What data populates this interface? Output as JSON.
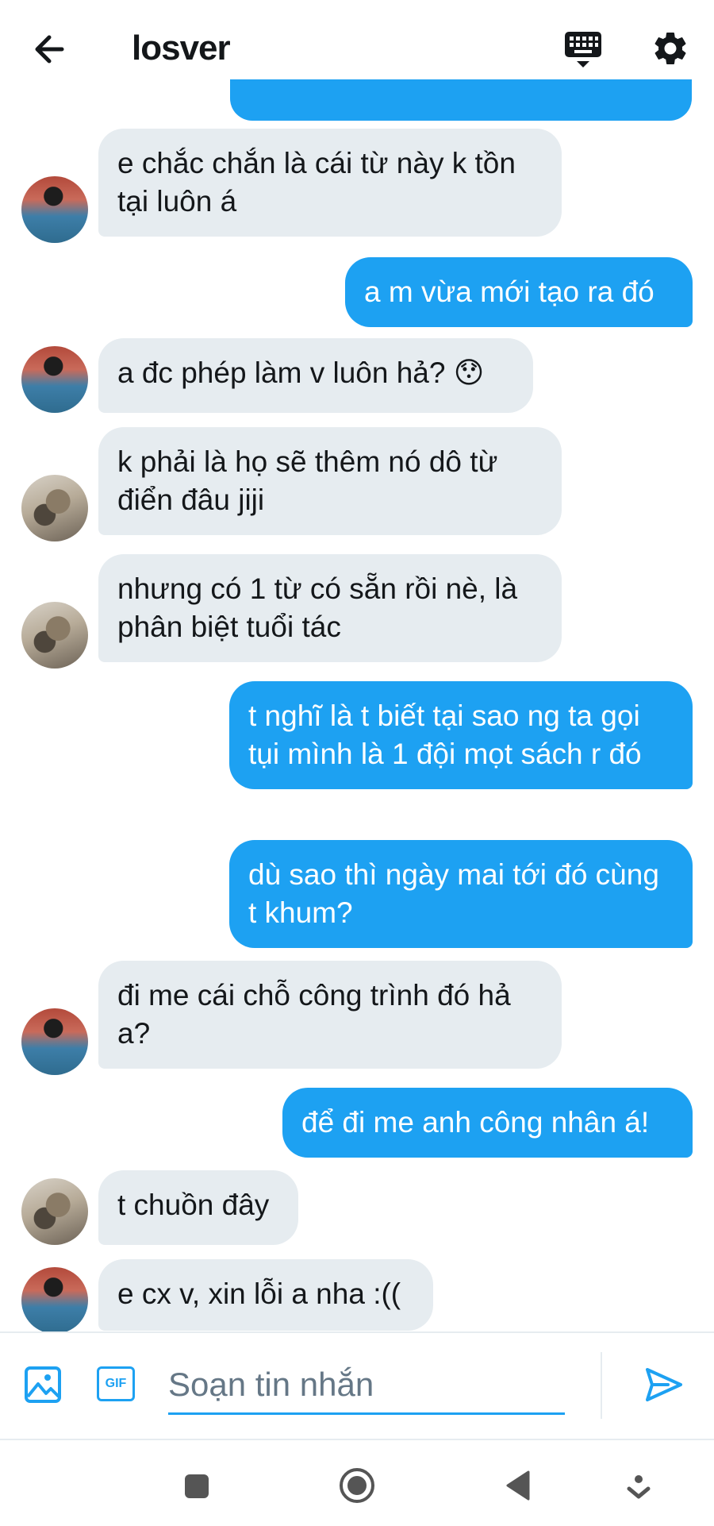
{
  "header": {
    "title": "losver",
    "back_icon": "arrow-left-icon",
    "keyboard_icon": "keyboard-icon",
    "settings_icon": "gear-icon"
  },
  "messages": [
    {
      "side": "in",
      "avatar": "a",
      "text": "e chắc chắn là cái từ này k tồn tại luôn á"
    },
    {
      "side": "out",
      "text": "a m vừa mới tạo ra đó"
    },
    {
      "side": "in",
      "avatar": "a",
      "text": "a đc phép làm v luôn hả? 😯"
    },
    {
      "side": "in",
      "avatar": "b",
      "text": "k phải là họ sẽ thêm nó dô từ điển đâu jiji"
    },
    {
      "side": "in",
      "avatar": "b",
      "text": "nhưng có 1 từ có sẵn rồi nè, là phân biệt tuổi tác"
    },
    {
      "side": "out",
      "text": "t nghĩ là t biết tại sao ng ta gọi tụi mình là 1 đội mọt sách r đó"
    },
    {
      "side": "out",
      "text": "dù sao thì ngày mai tới đó cùng t khum?"
    },
    {
      "side": "in",
      "avatar": "a",
      "text": "đi me cái chỗ công trình đó hả a?"
    },
    {
      "side": "out",
      "text": "để đi me anh công nhân á!"
    },
    {
      "side": "in",
      "avatar": "b",
      "text": "t chuồn đây"
    },
    {
      "side": "in",
      "avatar": "a",
      "text": "e cx v, xin lỗi a nha :(("
    }
  ],
  "composer": {
    "placeholder": "Soạn tin nhắn",
    "value": "",
    "gif_label": "GIF",
    "image_icon": "image-icon",
    "send_icon": "send-icon"
  },
  "navbar": {
    "icons": [
      "recent-apps-icon",
      "home-icon",
      "back-triangle-icon",
      "assistant-icon"
    ]
  },
  "colors": {
    "accent": "#1da1f2",
    "incoming_bubble": "#e6ecf0",
    "text": "#14171a",
    "placeholder": "#657786"
  }
}
